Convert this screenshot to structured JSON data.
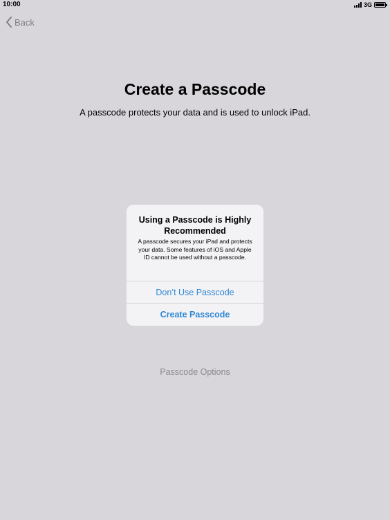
{
  "status_bar": {
    "time": "10:00",
    "network": "3G"
  },
  "nav": {
    "back_label": "Back"
  },
  "page": {
    "title": "Create a Passcode",
    "subtitle": "A passcode protects your data and is used to unlock iPad.",
    "options_label": "Passcode Options"
  },
  "alert": {
    "title": "Using a Passcode is Highly Recommended",
    "message": "A passcode secures your iPad and protects your data. Some features of iOS and Apple ID cannot be used without a passcode.",
    "buttons": [
      {
        "label": "Don’t Use Passcode"
      },
      {
        "label": "Create Passcode"
      }
    ]
  },
  "colors": {
    "background": "#d8d6da",
    "alert_background": "#f3f2f4",
    "link_blue": "#2f88d6",
    "muted_gray": "#8a888d"
  },
  "icons": [
    "signal-icon",
    "battery-icon",
    "chevron-left-icon"
  ]
}
